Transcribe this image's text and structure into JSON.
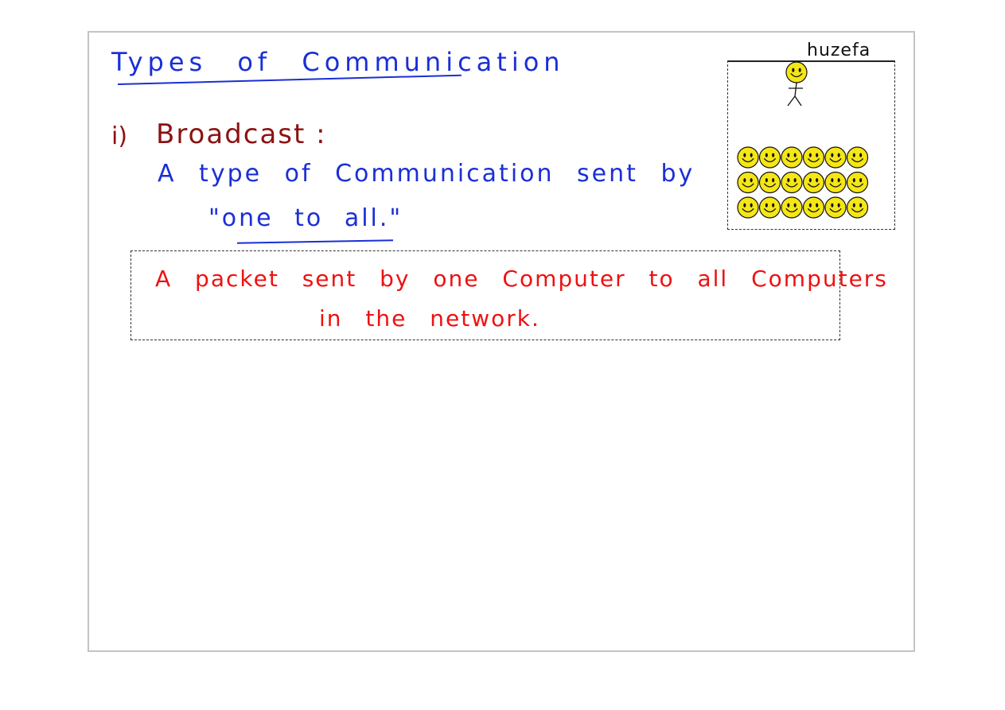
{
  "slide": {
    "title": "Types of Communication",
    "item_number": "i)",
    "heading": "Broadcast :",
    "definition_line1": "A type of Communication sent by",
    "definition_line2": "\"one to all.\"",
    "boxed_note_line1": "A packet sent by one Computer to all Computers",
    "boxed_note_line2": "in the network."
  },
  "figure": {
    "label": "huzefa",
    "crowd_rows": 3,
    "crowd_cols": 6,
    "face_color": "#f5e616"
  },
  "colors": {
    "title": "#1a2fd6",
    "heading": "#8b1212",
    "note": "#ee1111"
  }
}
